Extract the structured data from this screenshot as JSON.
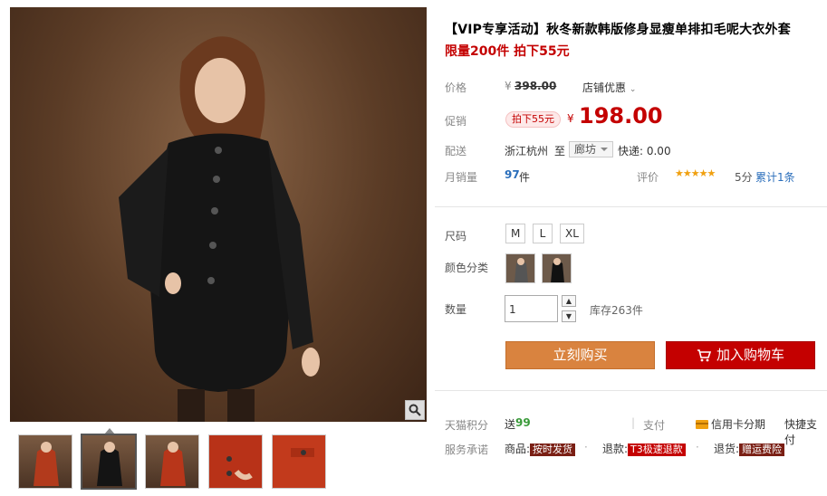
{
  "product": {
    "title": "【VIP专享活动】秋冬新款韩版修身显瘦单排扣毛呢大衣外套",
    "subtitle": "限量200件 拍下55元"
  },
  "price": {
    "label": "价格",
    "currency": "¥",
    "original": "398.00",
    "store_discount": "店铺优惠"
  },
  "promo": {
    "label": "促销",
    "tag": "拍下55元",
    "currency": "¥",
    "price": "198.00"
  },
  "shipping": {
    "label": "配送",
    "from": "浙江杭州",
    "to_word": "至",
    "to_city": "廊坊",
    "express": "快递: 0.00"
  },
  "sales": {
    "label": "月销量",
    "count": "97",
    "unit": "件",
    "rating_label": "评价",
    "stars": "★★★★★",
    "score": "5分",
    "reviews": "累计1条"
  },
  "sku": {
    "size_label": "尺码",
    "sizes": [
      "M",
      "L",
      "XL"
    ],
    "color_label": "颜色分类",
    "colors": [
      "gray",
      "black"
    ],
    "qty_label": "数量",
    "qty_value": "1",
    "stock": "库存263件"
  },
  "buttons": {
    "buy": "立刻购买",
    "cart": "加入购物车"
  },
  "points": {
    "label": "天猫积分",
    "send": "送",
    "value": "99",
    "pay_label": "支付",
    "credit": "信用卡分期",
    "fast": "快捷支付"
  },
  "service": {
    "label": "服务承诺",
    "goods": "商品:",
    "goods_tag": "按时发货",
    "refund": "退款:",
    "refund_tag": "T3极速退款",
    "return": "退货:",
    "return_tag": "赠运费险"
  },
  "colors": {
    "accent_red": "#c40000",
    "buy_orange": "#d9833f",
    "star": "#f0a010"
  }
}
